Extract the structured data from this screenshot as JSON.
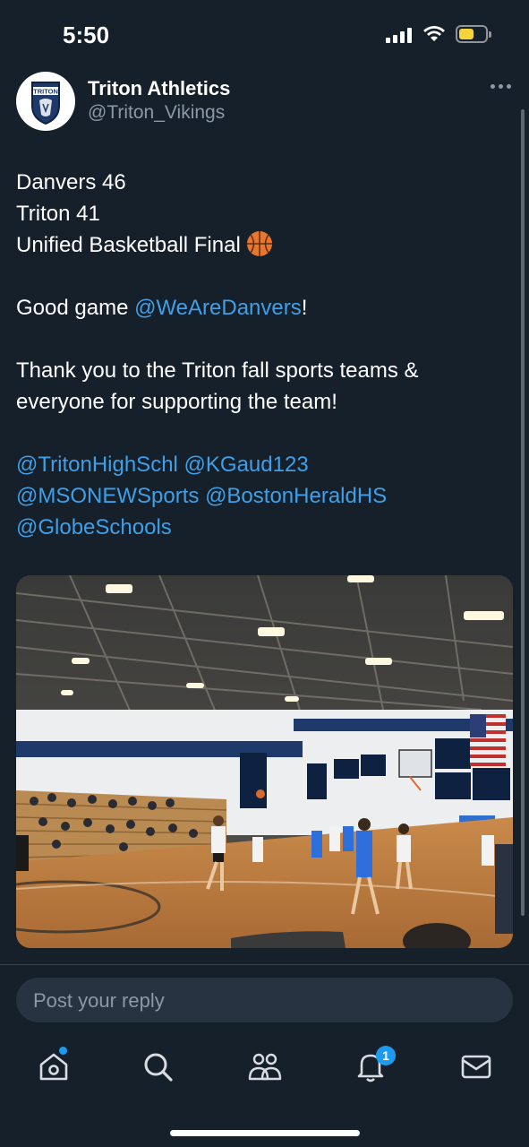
{
  "status_bar": {
    "time": "5:50",
    "battery_color": "#f4d33b"
  },
  "tweet": {
    "display_name": "Triton Athletics",
    "handle": "@Triton_Vikings",
    "avatar_text": "TRITON",
    "lines": {
      "line1": "Danvers 46",
      "line2": "Triton 41",
      "line3": "Unified Basketball Final",
      "good_game_prefix": "Good game ",
      "good_game_mention": "@WeAreDanvers",
      "good_game_suffix": "!",
      "thanks_line1": "Thank you to the Triton fall sports teams &",
      "thanks_line2": "everyone for supporting the team!"
    },
    "mentions": {
      "m1": "@TritonHighSchl",
      "m2": "@KGaud123",
      "m3": "@MSONEWSports",
      "m4": "@BostonHeraldHS",
      "m5": "@GlobeSchools"
    },
    "media_description_icon": "basketball-gym-photo",
    "mention_color": "#3f9fe8"
  },
  "reply": {
    "placeholder": "Post your reply"
  },
  "tab_bar": {
    "items": [
      "home-icon",
      "search-icon",
      "communities-icon",
      "notifications-icon",
      "messages-icon"
    ],
    "notification_count": "1",
    "accent": "#1d9bf0"
  }
}
